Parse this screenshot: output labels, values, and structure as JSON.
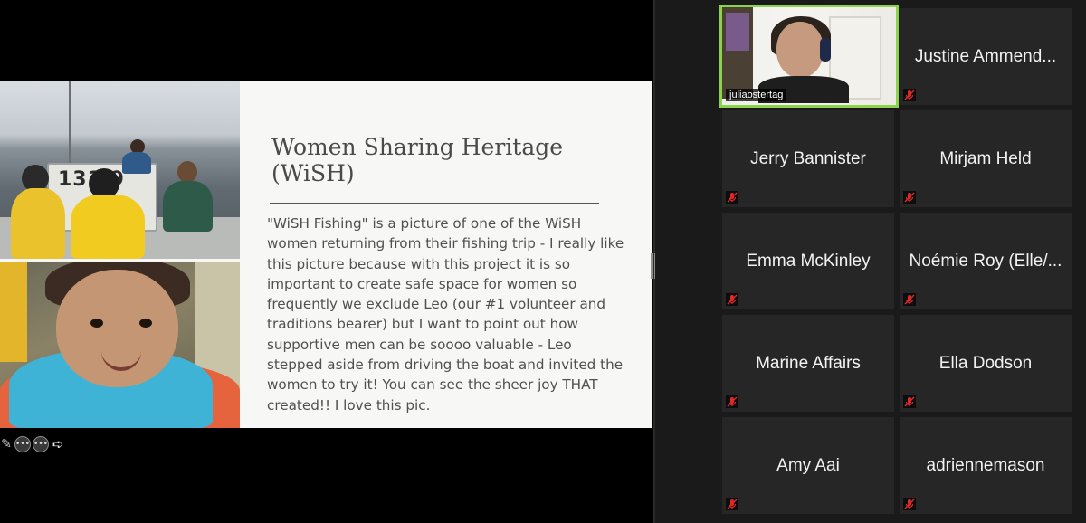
{
  "slide": {
    "title": "Women Sharing Heritage (WiSH)",
    "body": "\"WiSH Fishing\" is a picture of one of the WiSH women returning from their fishing trip - I really like this picture because with this project it is so important to create safe space for women so frequently we exclude Leo (our #1 volunteer and traditions bearer) but I want to point out how supportive men can be soooo valuable - Leo stepped aside from driving the boat and invited the women to try it! You can see the sheer joy THAT created!! I love this pic.",
    "boat_number": "131 9",
    "photos": [
      "boat-crew-photo",
      "smiling-child-photo"
    ]
  },
  "presentation_controls": {
    "icons": [
      "pen-icon",
      "more-icon",
      "more-icon",
      "pointer-icon"
    ],
    "more_label": "•••"
  },
  "gallery": {
    "active_speaker": {
      "name": "juliaostertag",
      "highlight_color": "#8bd34a"
    },
    "participants": [
      {
        "name": "Justine Ammend...",
        "muted": true
      },
      {
        "name": "Jerry Bannister",
        "muted": true
      },
      {
        "name": "Mirjam Held",
        "muted": true
      },
      {
        "name": "Emma McKinley",
        "muted": true
      },
      {
        "name": "Noémie Roy (Elle/...",
        "muted": true
      },
      {
        "name": "Marine Affairs",
        "muted": true
      },
      {
        "name": "Ella Dodson",
        "muted": true
      },
      {
        "name": "Amy Aai",
        "muted": true
      },
      {
        "name": "adriennemason",
        "muted": true
      }
    ],
    "mute_icon_color": "#e02828"
  }
}
